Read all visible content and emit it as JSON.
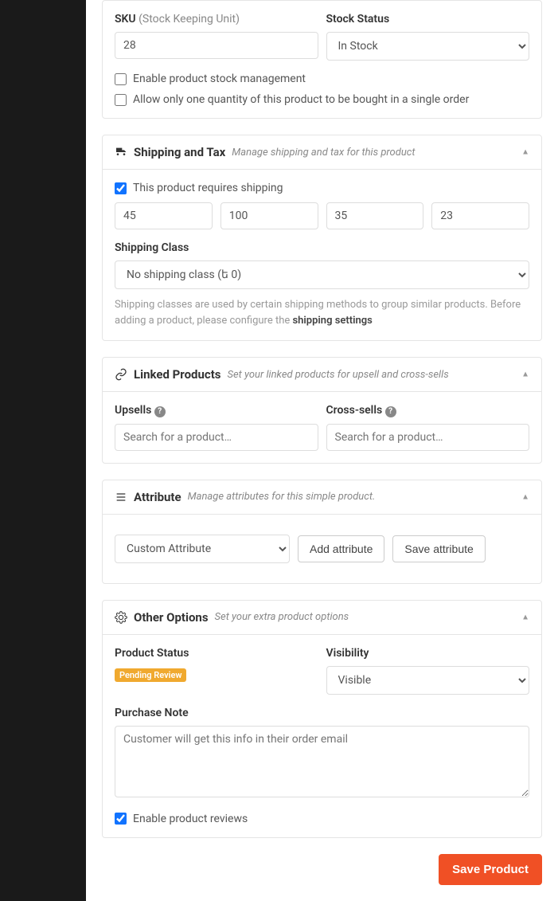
{
  "inventory": {
    "sku_label": "SKU",
    "sku_hint": "(Stock Keeping Unit)",
    "sku_value": "28",
    "stock_status_label": "Stock Status",
    "stock_status_value": "In Stock",
    "enable_stock_mgmt": "Enable product stock management",
    "single_qty": "Allow only one quantity of this product to be bought in a single order"
  },
  "shipping": {
    "title": "Shipping and Tax",
    "subtitle": "Manage shipping and tax for this product",
    "requires_shipping": "This product requires shipping",
    "weight": "45",
    "length": "100",
    "width": "35",
    "height": "23",
    "class_label": "Shipping Class",
    "class_value": "No shipping class (ե 0)",
    "helptext_pre": "Shipping classes are used by certain shipping methods to group similar products. Before adding a product, please configure the ",
    "helptext_link": "shipping settings"
  },
  "linked": {
    "title": "Linked Products",
    "subtitle": "Set your linked products for upsell and cross-sells",
    "upsells_label": "Upsells",
    "crosssells_label": "Cross-sells",
    "placeholder": "Search for a product…"
  },
  "attribute": {
    "title": "Attribute",
    "subtitle": "Manage attributes for this simple product.",
    "dropdown": "Custom Attribute",
    "add_btn": "Add attribute",
    "save_btn": "Save attribute"
  },
  "other": {
    "title": "Other Options",
    "subtitle": "Set your extra product options",
    "status_label": "Product Status",
    "status_badge": "Pending Review",
    "visibility_label": "Visibility",
    "visibility_value": "Visible",
    "purchase_note_label": "Purchase Note",
    "purchase_note_placeholder": "Customer will get this info in their order email",
    "enable_reviews": "Enable product reviews"
  },
  "save_button": "Save Product"
}
